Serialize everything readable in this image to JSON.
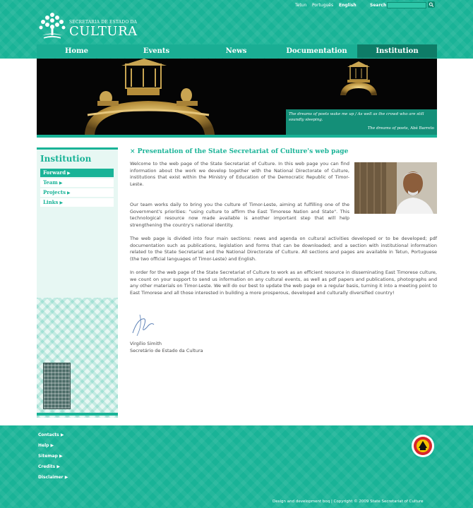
{
  "header": {
    "languages": [
      {
        "label": "Tetun",
        "active": false
      },
      {
        "label": "Português",
        "active": false
      },
      {
        "label": "English",
        "active": true
      }
    ],
    "search_label": "Search",
    "logo_small": "SECRETARIA DE ESTADO DA",
    "logo_big": "CULTURA"
  },
  "nav": {
    "items": [
      {
        "label": "Home",
        "active": false
      },
      {
        "label": "Events",
        "active": false
      },
      {
        "label": "News",
        "active": false
      },
      {
        "label": "Documentation",
        "active": false
      },
      {
        "label": "Institution",
        "active": true
      }
    ]
  },
  "banner": {
    "quote_line1": "The dreams of poets wake me up / As well as the crowd who are still",
    "quote_line2": "soundly sleeping.",
    "quote_title": "The dreams of poets,",
    "quote_author": "Abé Barreto"
  },
  "sidebar": {
    "title": "Institution",
    "items": [
      {
        "label": "Forward",
        "active": true
      },
      {
        "label": "Team",
        "active": false
      },
      {
        "label": "Projects",
        "active": false
      },
      {
        "label": "Links",
        "active": false
      }
    ]
  },
  "main": {
    "title": "× Presentation of the State Secretariat of Culture's web page",
    "paragraphs": [
      "Welcome to the web page of the State Secretariat of Culture. In this web page you can find information about the work we develop together with the National Directorate of Culture, institutions that exist within the Ministry of Education of the Democratic Republic of Timor-Leste.",
      "Our team works daily to bring you the culture of Timor-Leste, aiming at fulfilling one of the Government's priorities: \"using culture to affirm the East Timorese Nation and State\". This technological resource now made available is another important step that will help strengthening the country's national identity.",
      "The web page is divided into four main sections: news and agenda on cultural activities developed or to be developed; pdf documentation such as publications, legislation and forms that can be downloaded; and a section with institutional information related to the State Secretariat and the National Directorate of Culture. All sections and pages are available in Tetun, Portuguese (the two official languages of Timor-Leste) and English.",
      "In order for the web page of the State Secretariat of Culture to work as an efficient resource in disseminating East Timorese culture, we count on your support to send us information on any cultural events, as well as pdf papers and publications, photographs and any other materials on Timor-Leste. We will do our best to update the web page on a regular basis, turning it into a meeting point to East Timorese and all those interested in building a more prosperous, developed and culturally diversified country!"
    ],
    "signatory_name": "Virgílio Simith",
    "signatory_role": "Secretário de Estado da Cultura"
  },
  "footer": {
    "links": [
      "Contacts",
      "Help",
      "Sitemap",
      "Credits",
      "Disclaimer"
    ],
    "credit": "Design and development boq | Copyright © 2009 State Secretariat of Culture"
  },
  "colors": {
    "accent": "#19b397",
    "accent_dark": "#0e7c67",
    "text": "#4a4a4a"
  }
}
